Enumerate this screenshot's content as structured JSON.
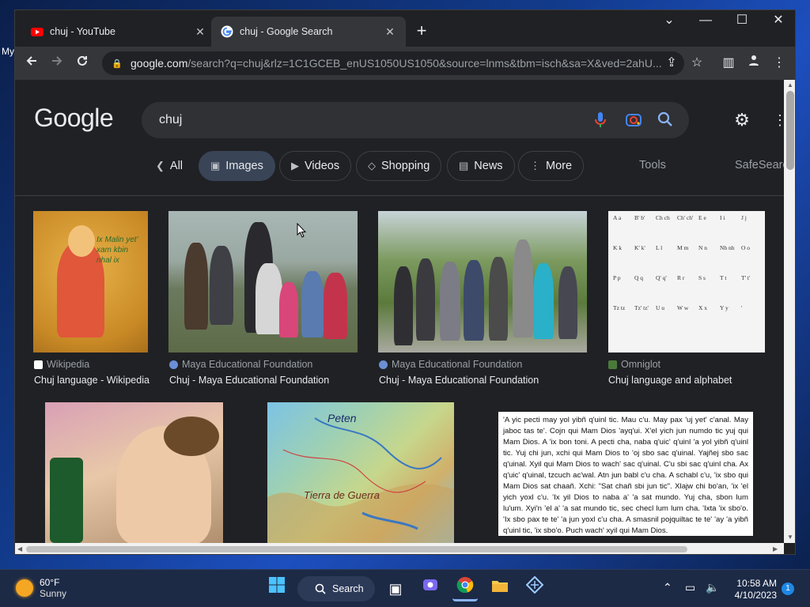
{
  "browser": {
    "tabs": [
      {
        "title": "chuj - YouTube",
        "close": "✕"
      },
      {
        "title": "chuj - Google Search",
        "close": "✕"
      }
    ],
    "new_tab": "+",
    "window_controls": {
      "dropdown": "⌄",
      "minimize": "—",
      "maximize": "☐",
      "close": "✕"
    },
    "url": {
      "host": "google.com",
      "path": "/search?q=chuj&rlz=1C1GCEB_enUS1050US1050&source=lnms&tbm=isch&sa=X&ved=2ahU..."
    }
  },
  "search": {
    "logo": "Google",
    "query": "chuj"
  },
  "chips": {
    "all": "All",
    "images": "Images",
    "videos": "Videos",
    "shopping": "Shopping",
    "news": "News",
    "more": "More",
    "tools": "Tools",
    "safesearch": "SafeSearch"
  },
  "results": [
    {
      "source": "Wikipedia",
      "caption": "Chuj language - Wikipedia",
      "drawing_text": "Ix Malin yet' xam kbin nhal ix"
    },
    {
      "source": "Maya Educational Foundation",
      "caption": "Chuj - Maya Educational Foundation"
    },
    {
      "source": "Maya Educational Foundation",
      "caption": "Chuj - Maya Educational Foundation"
    },
    {
      "source": "Omniglot",
      "caption": "Chuj language and alphabet"
    }
  ],
  "map_labels": [
    "Peten",
    "Tierra de Guerra"
  ],
  "verse_text": "'A yic pecti may yol yibñ q'uinl tic. Mau c'u. May pax 'uj yet' c'anal. May jaboc tas te'. Cojn qui Mam Dios 'ayq'ui. X'el yich jun numdo tic yuj qui Mam Dios. A 'ix bon toni. A pecti cha, naba q'uic' q'uinl 'a yol yibñ q'uinl tic. Yuj chi jun, xchi qui Mam Dios to 'oj sbo sac q'uinal. Yajñej sbo sac q'uinal. Xyil qui Mam Dios to wach' sac q'uinal. C'u sbi sac q'uinl cha. Ax q'uic' q'uinal, tzcuch ac'wal. Atn jun babl c'u cha. A schabl c'u, 'ix sbo qui Mam Dios sat chaañ. Xchi: \"Sat chañ sbi jun tic\". Xlajw chi bo'an, 'ix 'el yich yoxl c'u. 'Ix yil Dios to naba a' 'a sat mundo. Yuj cha, sbon lum lu'um. Xyi'n 'el a' 'a sat mundo tic, sec checl lum lum cha. 'Ixta 'ix sbo'o. 'Ix sbo pax te te' 'a jun yoxl c'u cha. A smasnil pojquiltac te te' 'ay 'a yibñ q'uinl tic, 'ix sbo'o. Puch wach' xyil qui Mam Dios.",
  "alphabet": [
    "A a",
    "B' b'",
    "Ch ch",
    "Ch' ch'",
    "E e",
    "I i",
    "J j",
    "K k",
    "K' k'",
    "L l",
    "M m",
    "N n",
    "Nh nh",
    "O o",
    "P p",
    "Q q",
    "Q' q'",
    "R r",
    "S s",
    "T t",
    "T' t'",
    "Tz tz",
    "Tz' tz'",
    "U u",
    "W w",
    "X x",
    "Y y",
    "'"
  ],
  "weather": {
    "temp": "60°F",
    "condition": "Sunny"
  },
  "taskbar": {
    "search_label": "Search"
  },
  "clock": {
    "time": "10:58 AM",
    "date": "4/10/2023"
  },
  "notifications": "1",
  "colors": {
    "youtube_red": "#ff0000",
    "accent_blue": "#8ab4f8",
    "page_bg": "#202124"
  }
}
